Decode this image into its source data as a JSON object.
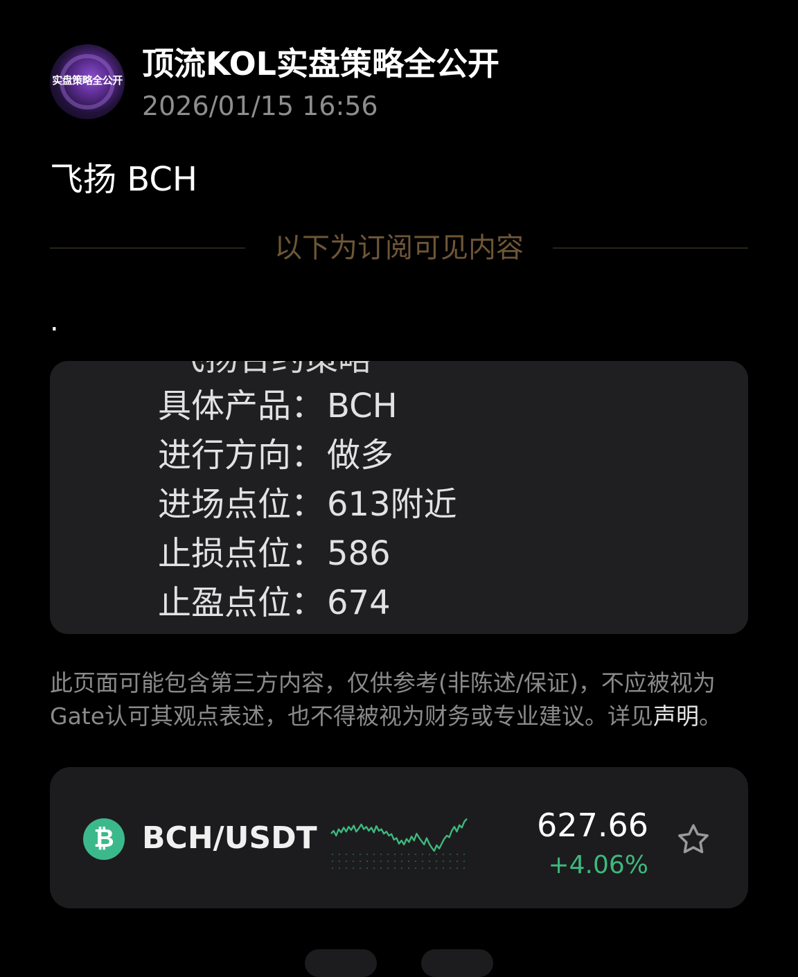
{
  "header": {
    "avatar_text": "实盘策略全公开",
    "channel_name": "顶流KOL实盘策略全公开",
    "timestamp": "2026/01/15 16:56"
  },
  "post": {
    "title": "飞扬 BCH",
    "divider_text": "以下为订阅可见内容",
    "dot": "."
  },
  "strategy": {
    "heading_partial": "飞扬合约策略",
    "rows": [
      {
        "label": "具体产品：",
        "value": "BCH"
      },
      {
        "label": "进行方向：",
        "value": "做多"
      },
      {
        "label": "进场点位：",
        "value": "613附近"
      },
      {
        "label": "止损点位：",
        "value": "586"
      },
      {
        "label": "止盈点位：",
        "value": "674"
      }
    ]
  },
  "disclaimer": {
    "text": "此页面可能包含第三方内容，仅供参考(非陈述/保证)，不应被视为Gate认可其观点表述，也不得被视为财务或专业建议。详见",
    "link_text": "声明",
    "end": "。"
  },
  "ticker": {
    "pair": "BCH/USDT",
    "price": "627.66",
    "change": "+4.06%",
    "coin_symbol": "₿",
    "icons": {
      "coin": "bch-coin-icon",
      "favorite": "star-icon"
    },
    "colors": {
      "up": "#3fb87d",
      "coin_bg": "#3cb98c"
    },
    "sparkline": [
      0.55,
      0.62,
      0.5,
      0.66,
      0.58,
      0.7,
      0.6,
      0.72,
      0.64,
      0.75,
      0.6,
      0.68,
      0.78,
      0.66,
      0.72,
      0.62,
      0.7,
      0.58,
      0.74,
      0.62,
      0.66,
      0.55,
      0.6,
      0.5,
      0.54,
      0.4,
      0.44,
      0.3,
      0.38,
      0.28,
      0.42,
      0.34,
      0.48,
      0.38,
      0.55,
      0.45,
      0.36,
      0.28,
      0.44,
      0.3,
      0.2,
      0.12,
      0.26,
      0.18,
      0.3,
      0.42,
      0.5,
      0.46,
      0.62,
      0.72,
      0.6,
      0.76,
      0.7,
      0.85,
      0.92
    ]
  }
}
